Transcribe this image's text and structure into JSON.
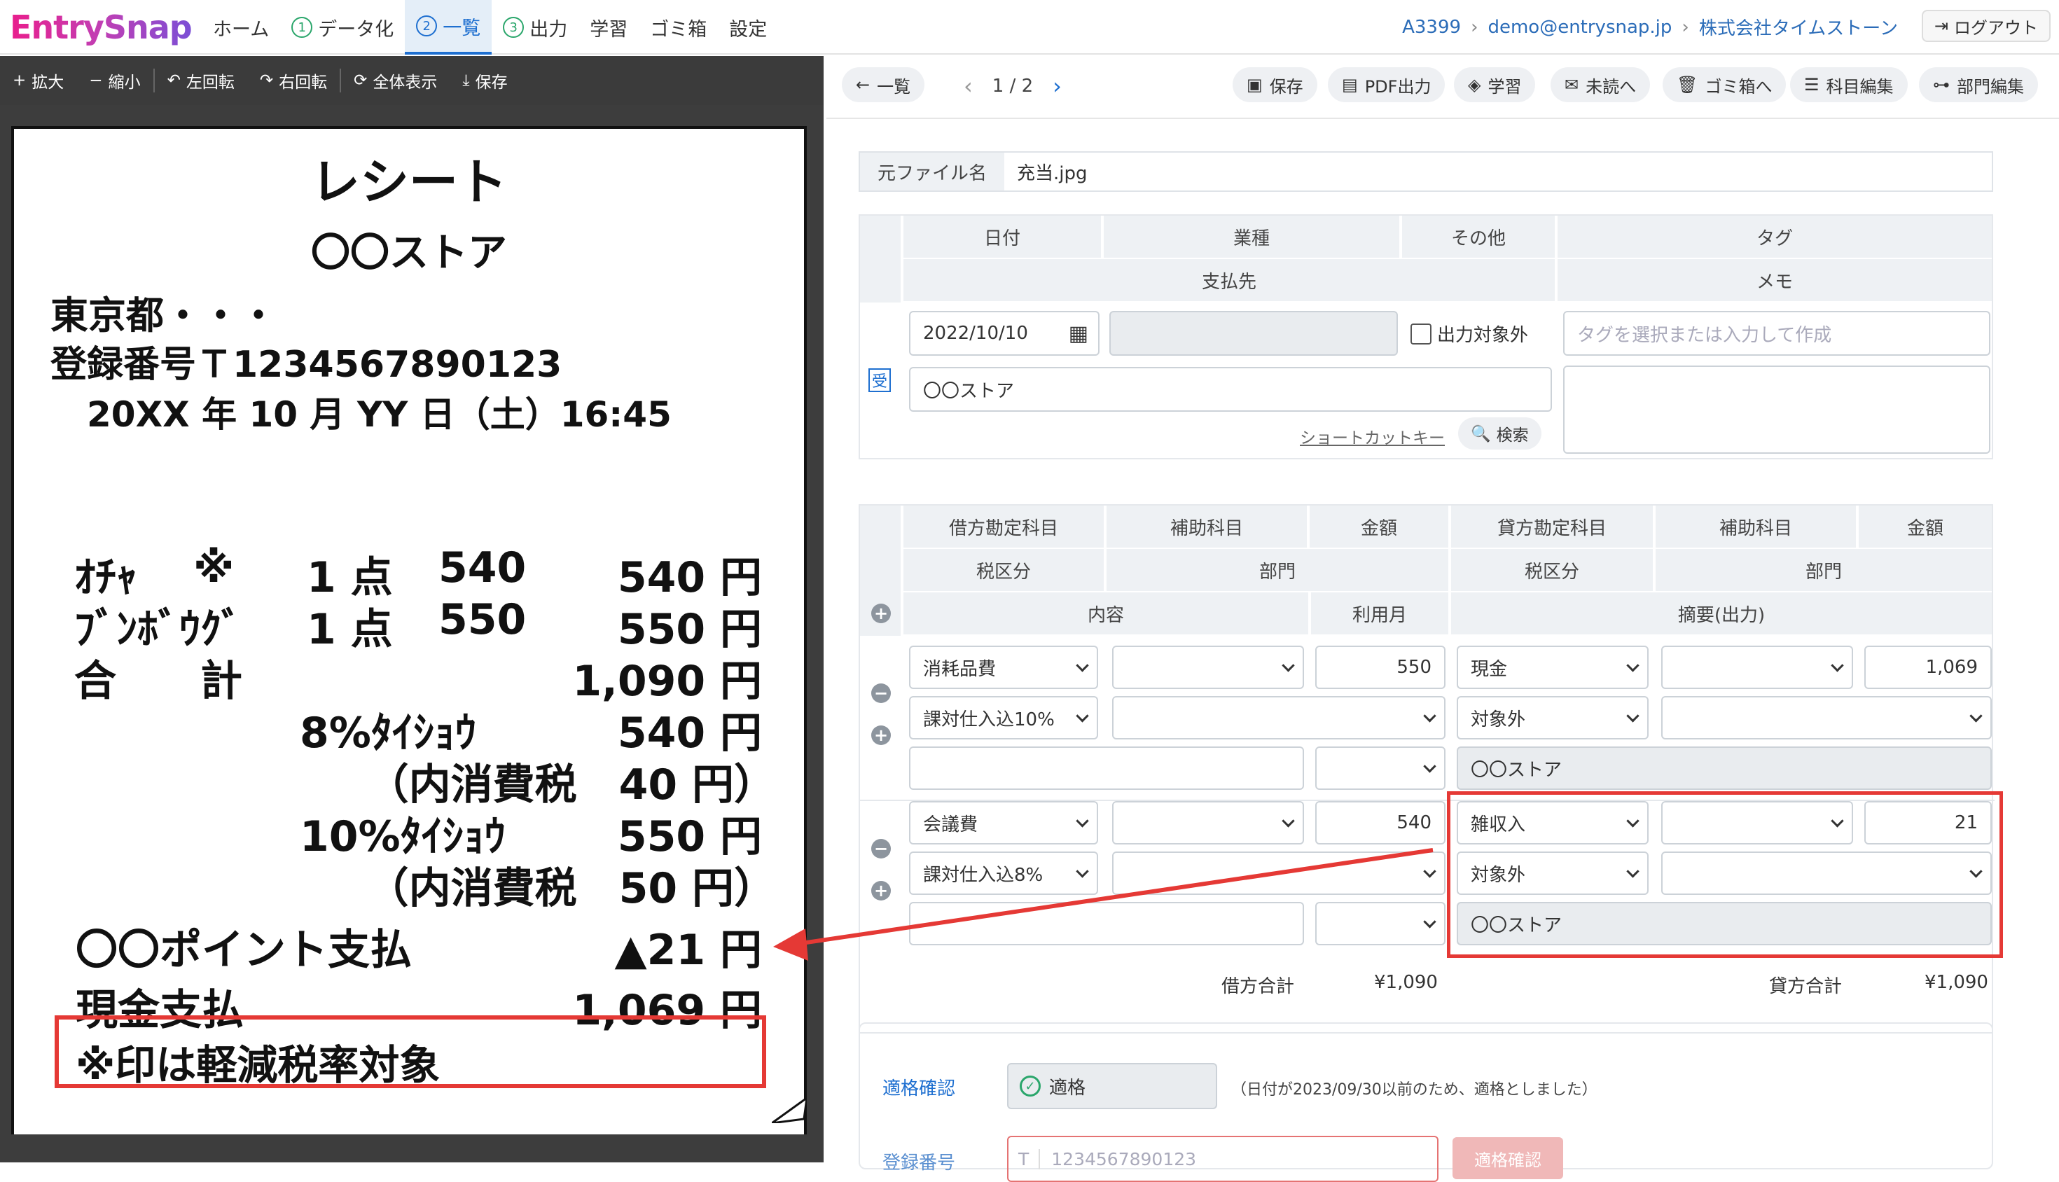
{
  "app": {
    "logo": "EntrySnap"
  },
  "nav": [
    {
      "num": "",
      "label": "ホーム"
    },
    {
      "num": "1",
      "label": "データ化"
    },
    {
      "num": "2",
      "label": "一覧"
    },
    {
      "num": "3",
      "label": "出力"
    },
    {
      "num": "",
      "label": "学習"
    },
    {
      "num": "",
      "label": "ゴミ箱"
    },
    {
      "num": "",
      "label": "設定"
    }
  ],
  "breadcrumb": {
    "account": "A3399",
    "email": "demo@entrysnap.jp",
    "company": "株式会社タイムストーン"
  },
  "logout": "ログアウト",
  "viewer_toolbar": {
    "zoom_in": "拡大",
    "zoom_out": "縮小",
    "rotate_left": "左回転",
    "rotate_right": "右回転",
    "fit": "全体表示",
    "save": "保存"
  },
  "receipt": {
    "title": "レシート",
    "store": "〇〇ストア",
    "address": "東京都・・・",
    "reg_no": "登録番号Ｔ1234567890123",
    "datetime": "20XX 年 10 月 YY 日（土）16:45",
    "items": [
      {
        "name": "ｵﾁｬ",
        "mark": "※",
        "qty": "1 点",
        "price": "540",
        "amount": "540 円"
      },
      {
        "name": "ﾌﾞﾝﾎﾞｳｸﾞ",
        "mark": "",
        "qty": "1 点",
        "price": "550",
        "amount": "550 円"
      }
    ],
    "total_label": "合　　計",
    "total": "1,090 円",
    "tax8_label": "8%ﾀｲｼｮｳ",
    "tax8": "540 円",
    "tax8_in": "（内消費税　40 円）",
    "tax10_label": "10%ﾀｲｼｮｳ",
    "tax10": "550 円",
    "tax10_in": "（内消費税　50 円）",
    "point_label": "〇〇ポイント支払",
    "point": "▲21 円",
    "cash_label": "現金支払",
    "cash": "1,069 円",
    "note": "※印は軽減税率対象"
  },
  "record_toolbar": {
    "back": "一覧",
    "page": "1 / 2",
    "save": "保存",
    "pdf": "PDF出力",
    "learn": "学習",
    "unread": "未読へ",
    "trash": "ゴミ箱へ",
    "account_edit": "科目編集",
    "dept_edit": "部門編集"
  },
  "file": {
    "label": "元ファイル名",
    "name": "充当.jpg"
  },
  "header_table": {
    "date": "日付",
    "industry": "業種",
    "other": "その他",
    "tag": "タグ",
    "payee": "支払先",
    "memo": "メモ",
    "date_value": "2022/10/10",
    "exclude": "出力対象外",
    "tag_placeholder": "タグを選択または入力して作成",
    "payee_value": "〇〇ストア",
    "receipt_icon": "受",
    "shortcut": "ショートカットキー",
    "search": "検索"
  },
  "journal": {
    "headers": {
      "debit": "借方勘定科目",
      "sub": "補助科目",
      "amount": "金額",
      "credit": "貸方勘定科目",
      "tax": "税区分",
      "dept": "部門",
      "content": "内容",
      "use_month": "利用月",
      "summary": "摘要(出力)"
    },
    "rows": [
      {
        "debit": "消耗品費",
        "debit_amount": "550",
        "credit": "現金",
        "credit_amount": "1,069",
        "debit_tax": "課対仕入込10%",
        "credit_tax": "対象外",
        "summary": "〇〇ストア"
      },
      {
        "debit": "会議費",
        "debit_amount": "540",
        "credit": "雑収入",
        "credit_amount": "21",
        "debit_tax": "課対仕入込8%",
        "credit_tax": "対象外",
        "summary": "〇〇ストア"
      }
    ],
    "debit_total_label": "借方合計",
    "debit_total": "¥1,090",
    "credit_total_label": "貸方合計",
    "credit_total": "¥1,090"
  },
  "invoice": {
    "label": "適格確認",
    "status": "適格",
    "note": "（日付が2023/09/30以前のため、適格としました）",
    "reg_label": "登録番号",
    "reg_prefix": "T",
    "reg_placeholder": "1234567890123",
    "check_button": "適格確認"
  },
  "colors": {
    "accent": "#1e6fd0",
    "highlight": "#e53935",
    "ok": "#2aa66b"
  }
}
